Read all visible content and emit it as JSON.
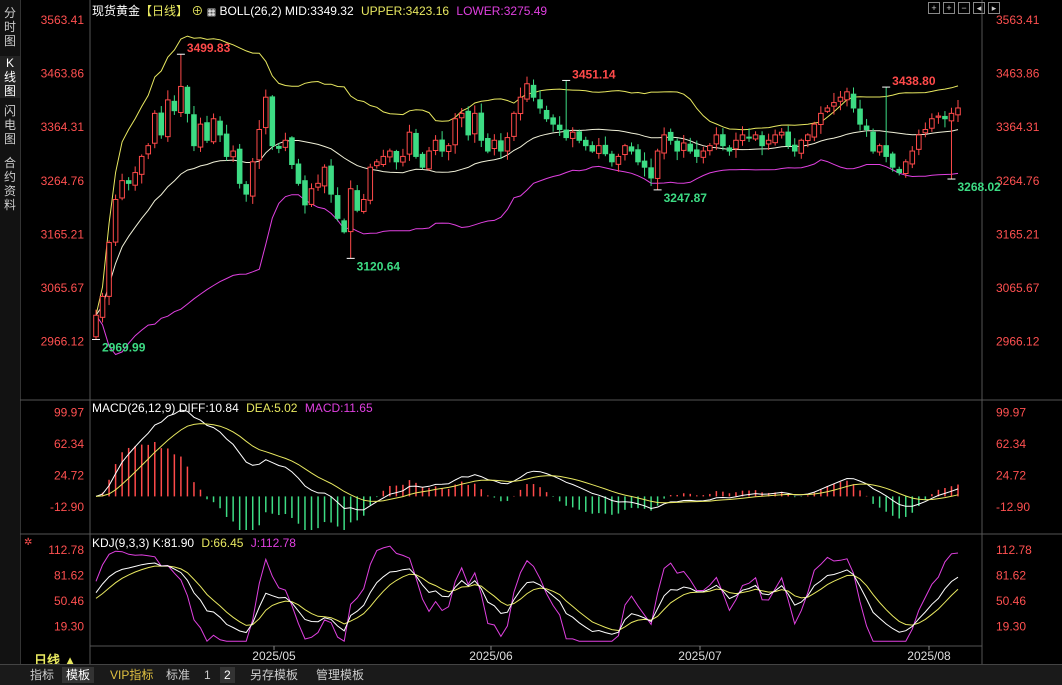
{
  "sidebar": {
    "tabs": [
      "分时图",
      "K线图",
      "闪电图",
      "合约资料"
    ],
    "active": 1
  },
  "panel_titles": {
    "main": {
      "name": "现货黄金",
      "period": "【日线】",
      "boll": "BOLL(26,2)",
      "mid": "MID:3349.32",
      "upper": "UPPER:3423.16",
      "lower": "LOWER:3275.49"
    },
    "macd": {
      "name": "MACD(26,12,9)",
      "diff": "DIFF:10.84",
      "dea": "DEA:5.02",
      "macd": "MACD:11.65"
    },
    "kdj": {
      "name": "KDJ(9,3,3)",
      "k": "K:81.90",
      "d": "D:66.45",
      "j": "J:112.78"
    }
  },
  "period_label": "日线 ▲",
  "bottom_tabs": [
    "指标",
    "模板",
    "VIP指标",
    "标准",
    "1",
    "2",
    "另存模板",
    "管理模板"
  ],
  "colors": {
    "up": "#ff4a4a",
    "down": "#3ddc84",
    "mid": "#f0f0d8",
    "upper": "#e8e860",
    "lower": "#e040e0",
    "dea": "#e8e860",
    "j": "#e040e0",
    "axis_text": "#ff5050"
  },
  "chart_data": [
    {
      "type": "candlestick",
      "title": "现货黄金【日线】",
      "y_ticks": [
        3563.41,
        3463.86,
        3364.31,
        3264.76,
        3165.21,
        3065.67,
        2966.12
      ],
      "ylim": [
        2865,
        3563.41
      ],
      "x_ticks": [
        "2025/05",
        "2025/06",
        "2025/07",
        "2025/08"
      ],
      "annotations": [
        {
          "label": "3499.83",
          "bar": 13,
          "kind": "high"
        },
        {
          "label": "2969.99",
          "bar": 0,
          "kind": "low"
        },
        {
          "label": "3120.64",
          "bar": 39,
          "kind": "low"
        },
        {
          "label": "3451.14",
          "bar": 72,
          "kind": "high"
        },
        {
          "label": "3247.87",
          "bar": 86,
          "kind": "low"
        },
        {
          "label": "3438.80",
          "bar": 121,
          "kind": "high"
        },
        {
          "label": "3268.02",
          "bar": 131,
          "kind": "low"
        }
      ],
      "ohlc_seed": [
        3015,
        3050,
        3150,
        3230,
        3265,
        3260,
        3280,
        3310,
        3330,
        3390,
        3350,
        3415,
        3395,
        3440,
        3390,
        3330,
        3370,
        3340,
        3380,
        3350,
        3310,
        3320,
        3260,
        3240,
        3300,
        3360,
        3420,
        3330,
        3325,
        3340,
        3295,
        3260,
        3220,
        3250,
        3260,
        3290,
        3240,
        3195,
        3170,
        3250,
        3210,
        3230,
        3290,
        3300,
        3310,
        3320,
        3300,
        3310,
        3355,
        3310,
        3290,
        3320,
        3340,
        3320,
        3330,
        3380,
        3390,
        3350,
        3390,
        3340,
        3320,
        3340,
        3320,
        3345,
        3390,
        3420,
        3445,
        3420,
        3400,
        3380,
        3370,
        3360,
        3345,
        3355,
        3340,
        3330,
        3320,
        3330,
        3315,
        3300,
        3310,
        3330,
        3320,
        3300,
        3290,
        3270,
        3320,
        3350,
        3340,
        3320,
        3335,
        3320,
        3310,
        3320,
        3330,
        3350,
        3330,
        3320,
        3340,
        3350,
        3345,
        3350,
        3330,
        3340,
        3350,
        3355,
        3330,
        3320,
        3340,
        3350,
        3370,
        3390,
        3400,
        3410,
        3420,
        3430,
        3400,
        3370,
        3360,
        3320,
        3330,
        3310,
        3290,
        3280,
        3300,
        3320,
        3350,
        3360,
        3380,
        3385,
        3380,
        3390,
        3400
      ]
    },
    {
      "type": "bar+line",
      "title": "MACD(26,12,9)",
      "y_ticks": [
        99.97,
        62.34,
        24.72,
        -12.9
      ],
      "ylim": [
        -40,
        110
      ]
    },
    {
      "type": "line",
      "title": "KDJ(9,3,3)",
      "y_ticks": [
        112.78,
        81.62,
        50.46,
        19.3
      ],
      "ylim": [
        0,
        125
      ]
    }
  ]
}
